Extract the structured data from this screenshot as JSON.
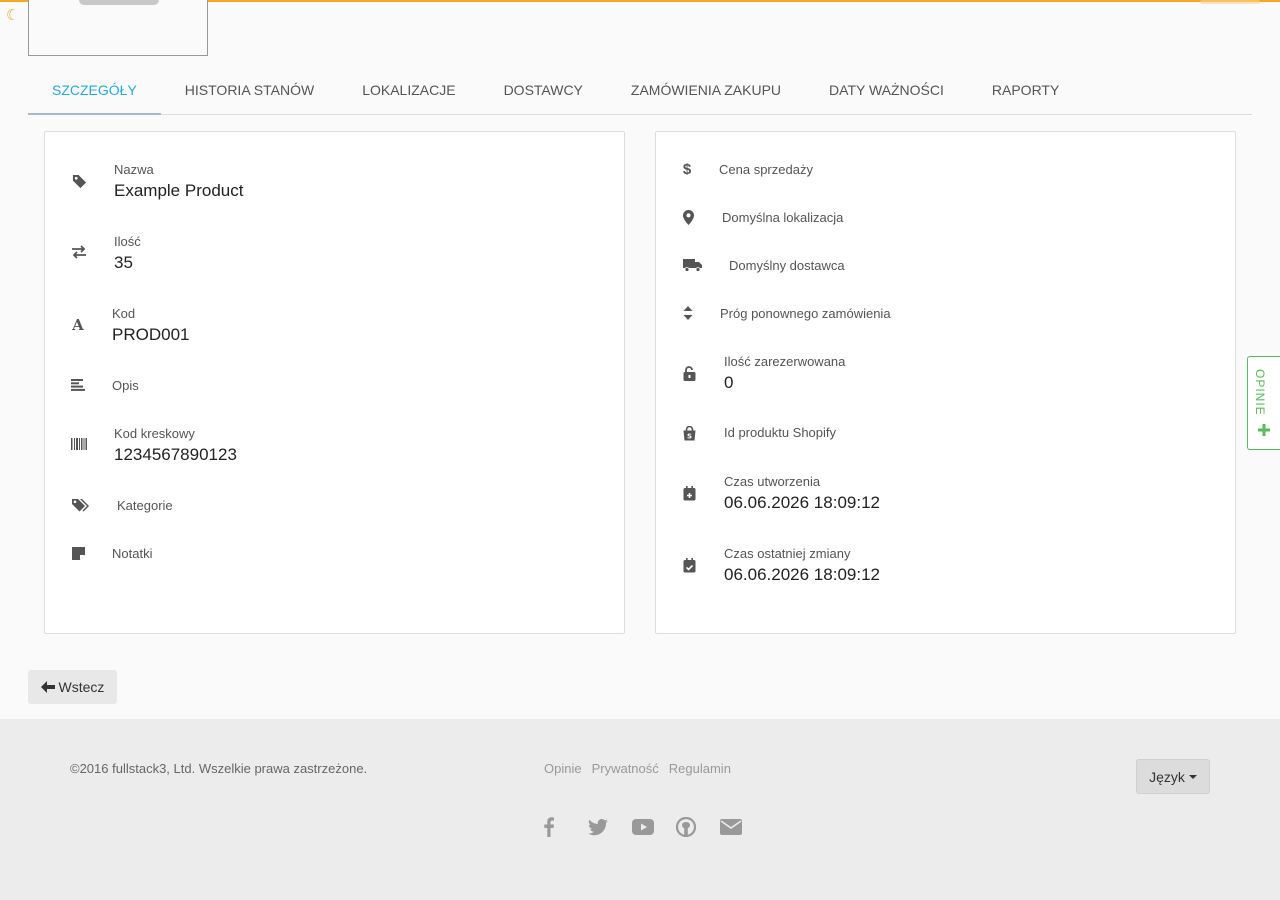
{
  "tabs": [
    {
      "label": "SZCZEGÓŁY",
      "active": true
    },
    {
      "label": "HISTORIA STANÓW"
    },
    {
      "label": "LOKALIZACJE"
    },
    {
      "label": "DOSTAWCY"
    },
    {
      "label": "ZAMÓWIENIA ZAKUPU"
    },
    {
      "label": "DATY WAŻNOŚCI"
    },
    {
      "label": "RAPORTY"
    }
  ],
  "left_card": {
    "name": {
      "label": "Nazwa",
      "value": "Example Product",
      "icon": "tag-icon"
    },
    "quantity": {
      "label": "Ilość",
      "value": "35",
      "icon": "exchange-icon"
    },
    "code": {
      "label": "Kod",
      "value": "PROD001",
      "icon": "font-icon"
    },
    "description": {
      "label": "Opis",
      "icon": "align-left-icon"
    },
    "barcode": {
      "label": "Kod kreskowy",
      "value": "1234567890123",
      "icon": "barcode-icon"
    },
    "categories": {
      "label": "Kategorie",
      "icon": "tags-icon"
    },
    "notes": {
      "label": "Notatki",
      "icon": "sticky-note-icon"
    }
  },
  "right_card": {
    "price": {
      "label": "Cena sprzedaży",
      "icon": "dollar-icon"
    },
    "default_location": {
      "label": "Domyślna lokalizacja",
      "icon": "map-marker-icon"
    },
    "default_supplier": {
      "label": "Domyślny dostawca",
      "icon": "truck-icon"
    },
    "reorder_threshold": {
      "label": "Próg ponownego zamówienia",
      "icon": "sort-icon"
    },
    "reserved": {
      "label": "Ilość zarezerwowana",
      "value": "0",
      "icon": "unlock-icon"
    },
    "shopify_id": {
      "label": "Id produktu Shopify",
      "icon": "shopify-icon"
    },
    "created": {
      "label": "Czas utworzenia",
      "value": "06.06.2026 18:09:12",
      "icon": "calendar-plus-icon"
    },
    "modified": {
      "label": "Czas ostatniej zmiany",
      "value": "06.06.2026 18:09:12",
      "icon": "calendar-check-icon"
    }
  },
  "back_button": {
    "label": "Wstecz",
    "icon": "arrow-left-icon"
  },
  "footer": {
    "copyright": "©2016 fullstack3, Ltd. Wszelkie prawa zastrzeżone.",
    "links": [
      "Opinie",
      "Prywatność",
      "Regulamin"
    ],
    "social_icons": [
      "facebook-icon",
      "twitter-icon",
      "youtube-icon",
      "github-icon",
      "envelope-icon"
    ],
    "language_button": "Język"
  },
  "feedback_tab": {
    "label": "OPINIE"
  },
  "colors": {
    "accent": "#29a9e1",
    "loader": "#f5a623",
    "feedback": "#5cb85c"
  }
}
